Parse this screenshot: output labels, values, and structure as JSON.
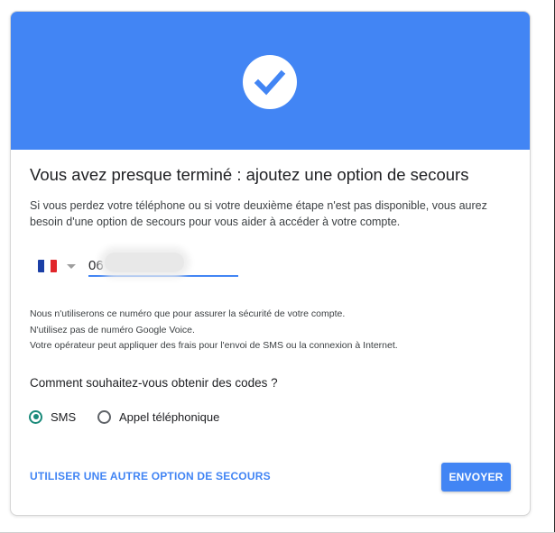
{
  "colors": {
    "accent": "#4285f4",
    "selected_radio": "#1a8a7a"
  },
  "banner": {
    "icon": "check-circle-icon"
  },
  "title": "Vous avez presque terminé : ajoutez une option de secours",
  "description": "Si vous perdez votre téléphone ou si votre deuxième étape n'est pas disponible, vous aurez besoin d'une option de secours pour vous aider à accéder à votre compte.",
  "phone": {
    "country_flag": "france-flag-icon",
    "value": "06"
  },
  "notes": [
    "Nous n'utiliserons ce numéro que pour assurer la sécurité de votre compte.",
    "N'utilisez pas de numéro Google Voice.",
    "Votre opérateur peut appliquer des frais pour l'envoi de SMS ou la connexion à Internet."
  ],
  "question": "Comment souhaitez-vous obtenir des codes ?",
  "options": [
    {
      "label": "SMS",
      "selected": true
    },
    {
      "label": "Appel téléphonique",
      "selected": false
    }
  ],
  "actions": {
    "alternate_label": "UTILISER UNE AUTRE OPTION DE SECOURS",
    "submit_label": "ENVOYER"
  }
}
